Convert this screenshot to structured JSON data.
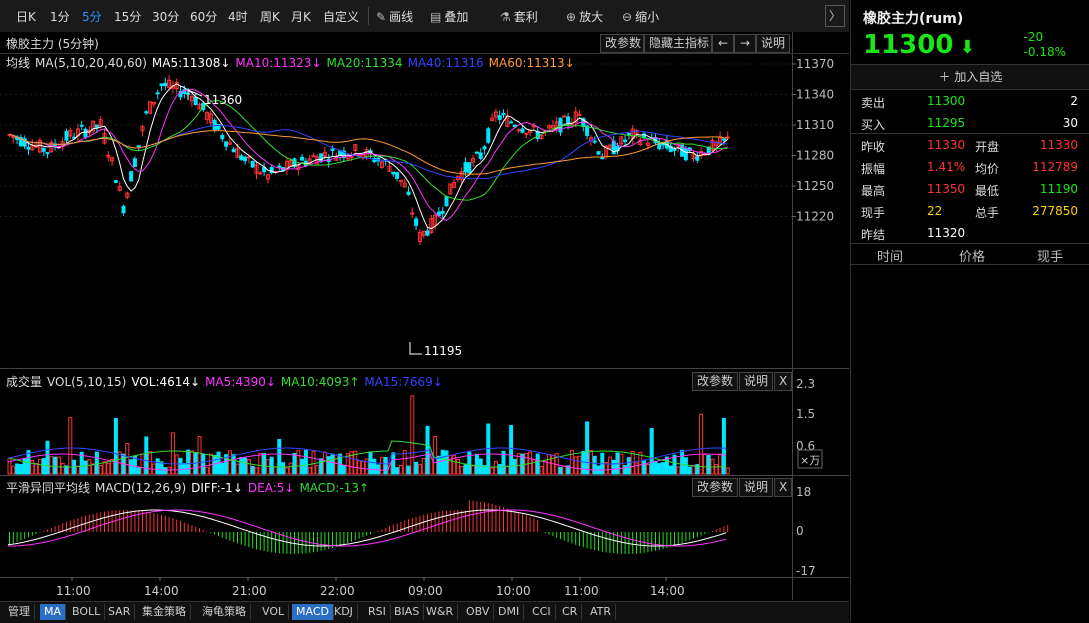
{
  "toolbar": {
    "periods": [
      "日K",
      "1分",
      "5分",
      "15分",
      "30分",
      "60分",
      "4时",
      "周K",
      "月K",
      "自定义"
    ],
    "active_period": "5分",
    "tools": [
      "画线",
      "叠加",
      "套利",
      "放大",
      "缩小"
    ]
  },
  "main_panel": {
    "title": "橡胶主力 (5分钟)",
    "buttons": [
      "改参数",
      "隐藏主指标",
      "←",
      "→",
      "说明"
    ],
    "legend_prefix": "均线",
    "legend": [
      {
        "text": "MA(5,10,20,40,60)",
        "color": "#dddddd"
      },
      {
        "text": "MA5:11308↓",
        "color": "#ffffff"
      },
      {
        "text": "MA10:11323↓",
        "color": "#ff33ff"
      },
      {
        "text": "MA20:11334",
        "color": "#33dd33"
      },
      {
        "text": "MA40:11316",
        "color": "#3344ff"
      },
      {
        "text": "MA60:11313↓",
        "color": "#ff9933"
      }
    ],
    "y_ticks": [
      "11370",
      "11340",
      "11310",
      "11280",
      "11250",
      "11220"
    ],
    "y_tick_values": [
      11370,
      11340,
      11310,
      11280,
      11250,
      11220
    ],
    "annotations": [
      "11360",
      "11195"
    ]
  },
  "volume_panel": {
    "title": "成交量",
    "legend": [
      {
        "text": "VOL(5,10,15)",
        "color": "#dddddd"
      },
      {
        "text": "VOL:4614↓",
        "color": "#ffffff"
      },
      {
        "text": "MA5:4390↓",
        "color": "#ff33ff"
      },
      {
        "text": "MA10:4093↑",
        "color": "#33dd33"
      },
      {
        "text": "MA15:7669↓",
        "color": "#3344ff"
      }
    ],
    "buttons": [
      "改参数",
      "说明",
      "X"
    ],
    "y_ticks": [
      "2.3",
      "1.5",
      "0.6"
    ],
    "unit": "×万"
  },
  "macd_panel": {
    "title": "平滑异同平均线",
    "legend": [
      {
        "text": "MACD(12,26,9)",
        "color": "#dddddd"
      },
      {
        "text": "DIFF:-1↓",
        "color": "#ffffff"
      },
      {
        "text": "DEA:5↓",
        "color": "#ff33ff"
      },
      {
        "text": "MACD:-13↑",
        "color": "#33dd33"
      }
    ],
    "buttons": [
      "改参数",
      "说明",
      "X"
    ],
    "y_ticks": [
      "18",
      "0",
      "-17"
    ]
  },
  "x_ticks": [
    "11:00",
    "14:00",
    "21:00",
    "22:00",
    "09:00",
    "10:00",
    "11:00",
    "14:00"
  ],
  "bottom_tabs": [
    "管理",
    "MA",
    "BOLL",
    "SAR",
    "集金策略",
    "海龟策略",
    "VOL",
    "MACD",
    "KDJ",
    "RSI",
    "BIAS",
    "W&R",
    "OBV",
    "DMI",
    "CCI",
    "CR",
    "ATR"
  ],
  "bottom_active": [
    "MA",
    "MACD"
  ],
  "quote": {
    "name": "橡胶主力(rum)",
    "price": "11300",
    "change": "-20",
    "change_pct": "-0.18%",
    "add_watch": "加入自选",
    "sell_label": "卖出",
    "sell_price": "11300",
    "sell_qty": "2",
    "buy_label": "买入",
    "buy_price": "11295",
    "buy_qty": "30",
    "rows": [
      {
        "l1": "昨收",
        "v1": "11330",
        "c1": "red",
        "l2": "开盘",
        "v2": "11330",
        "c2": "red"
      },
      {
        "l1": "振幅",
        "v1": "1.41%",
        "c1": "red",
        "l2": "均价",
        "v2": "112789",
        "c2": "red"
      },
      {
        "l1": "最高",
        "v1": "11350",
        "c1": "red",
        "l2": "最低",
        "v2": "11190",
        "c2": "green"
      },
      {
        "l1": "现手",
        "v1": "22",
        "c1": "yellow",
        "l2": "总手",
        "v2": "277850",
        "c2": "yellow"
      }
    ],
    "settle_label": "昨结",
    "settle_value": "11320",
    "trade_headers": [
      "时间",
      "价格",
      "现手"
    ]
  },
  "colors": {
    "up": "#ff3333",
    "down": "#00e5ff",
    "green": "#19e619",
    "accent": "#2b8fff"
  }
}
